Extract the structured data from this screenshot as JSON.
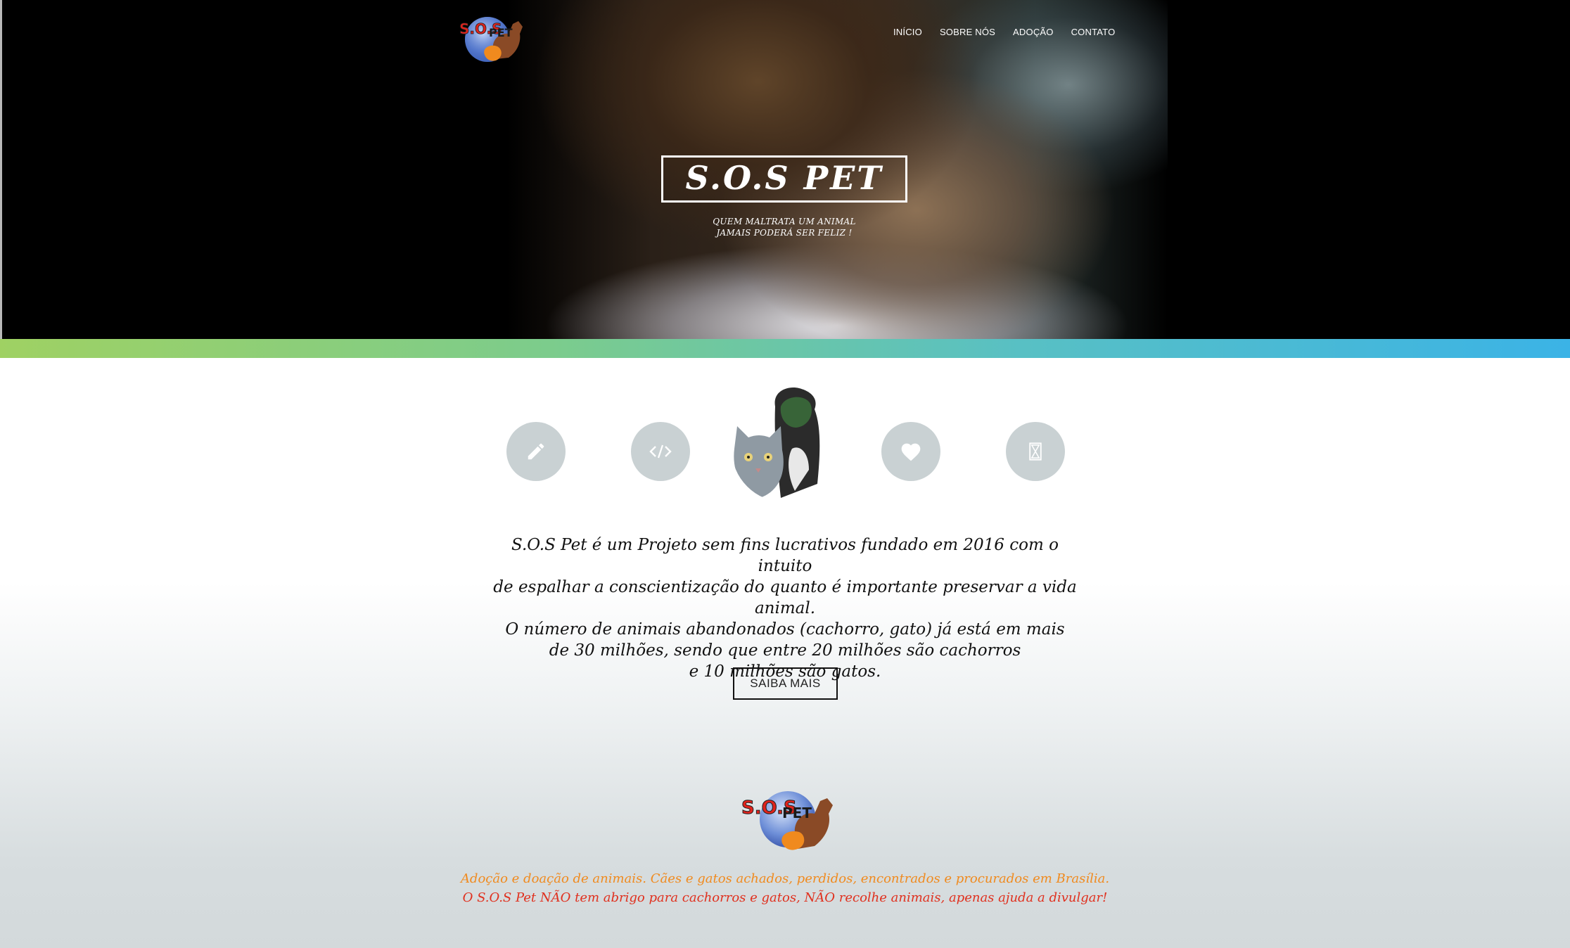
{
  "brand": {
    "logo_text_top": "S.O.S",
    "logo_text_pet": "PET"
  },
  "nav": {
    "items": [
      "INÍCIO",
      "SOBRE NÓS",
      "ADOÇÃO",
      "CONTATO"
    ]
  },
  "hero": {
    "title": "S.O.S PET",
    "subtitle_line1": "QUEM MALTRATA UM ANIMAL",
    "subtitle_line2": "JAMAIS PODERÁ SER FELIZ !"
  },
  "features": {
    "icons": [
      "pencil-icon",
      "code-icon",
      "pets-photo",
      "heart-icon",
      "hourglass-icon"
    ],
    "colors": {
      "circle_bg": "#c9d1d3",
      "icon": "#ffffff"
    }
  },
  "about": {
    "lines": [
      "S.O.S Pet é um Projeto sem fins lucrativos fundado em 2016 com o intuito",
      "de espalhar a conscientização do quanto é importante preservar a vida animal.",
      "O número de animais abandonados (cachorro, gato) já está em mais",
      "de 30 milhões, sendo que entre 20 milhões são cachorros",
      "e 10 milhões são gatos."
    ],
    "button_label": "SAIBA MAIS"
  },
  "footer": {
    "line1": "Adoção e doação de animais. Cães e gatos achados, perdidos, encontrados e procurados em Brasília.",
    "line2": "O S.O.S Pet NÃO tem abrigo para cachorros e gatos, NÃO recolhe animais, apenas ajuda a divulgar!",
    "colors": {
      "line1": "#f08a1e",
      "line2": "#e0301e"
    }
  },
  "colors": {
    "strip_start": "#9fd163",
    "strip_end": "#3bb3e6",
    "hero_bg": "#000000"
  }
}
